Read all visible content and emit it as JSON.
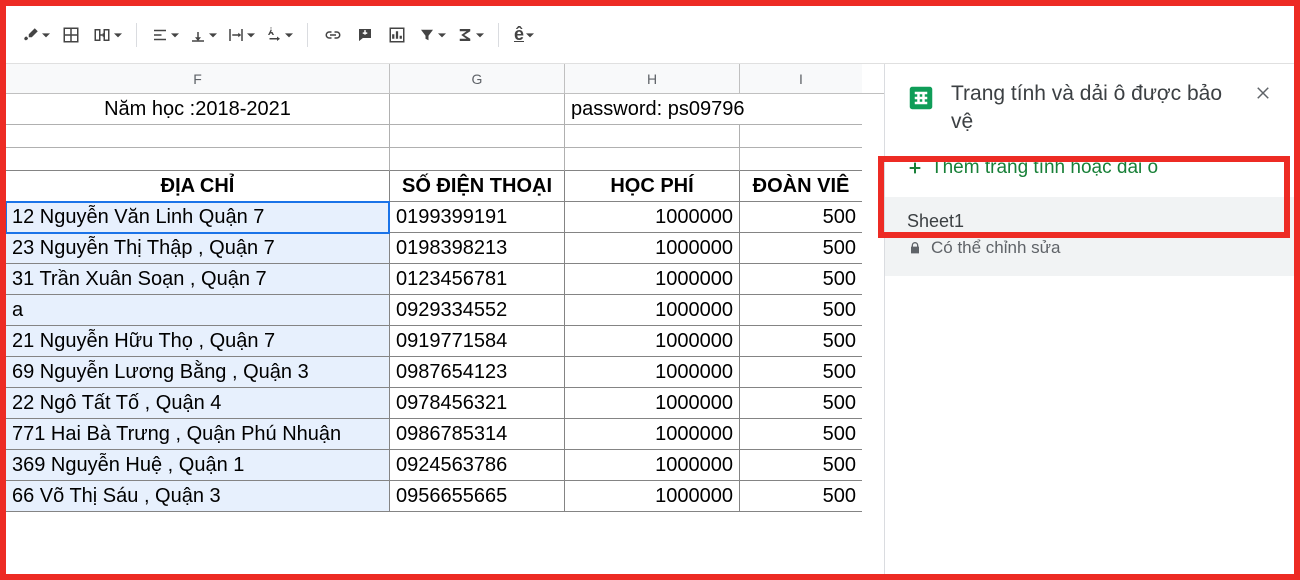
{
  "toolbar": {
    "icons": [
      "paint-icon",
      "borders-icon",
      "merge-icon",
      "halign-icon",
      "valign-icon",
      "wrap-icon",
      "rotate-icon",
      "link-icon",
      "insert-comment-icon",
      "chart-icon",
      "filter-icon",
      "functions-icon",
      "language-icon"
    ]
  },
  "columns": [
    "F",
    "G",
    "H",
    "I"
  ],
  "topmerge": {
    "left": "Năm học :2018-2021",
    "right": "password: ps09796"
  },
  "headers": {
    "F": "ĐỊA CHỈ",
    "G": "SỐ ĐIỆN THOẠI",
    "H": "HỌC PHÍ",
    "I": "ĐOÀN VIÊ"
  },
  "rows": [
    {
      "F": "12 Nguyễn Văn Linh Quận 7",
      "G": "0199399191",
      "H": "1000000",
      "I": "500"
    },
    {
      "F": "23 Nguyễn Thị Thập , Quận 7",
      "G": "0198398213",
      "H": "1000000",
      "I": "500"
    },
    {
      "F": "31 Trần Xuân Soạn , Quận 7",
      "G": "0123456781",
      "H": "1000000",
      "I": "500"
    },
    {
      "F": "a",
      "G": "0929334552",
      "H": "1000000",
      "I": "500"
    },
    {
      "F": "21 Nguyễn Hữu Thọ , Quận 7",
      "G": "0919771584",
      "H": "1000000",
      "I": "500"
    },
    {
      "F": "69 Nguyễn Lương Bằng , Quận 3",
      "G": "0987654123",
      "H": "1000000",
      "I": "500"
    },
    {
      "F": "22 Ngô Tất Tố , Quận 4",
      "G": "0978456321",
      "H": "1000000",
      "I": "500"
    },
    {
      "F": "771 Hai Bà Trưng , Quận Phú Nhuận",
      "G": "0986785314",
      "H": "1000000",
      "I": "500"
    },
    {
      "F": "369 Nguyễn Huệ , Quận 1",
      "G": "0924563786",
      "H": "1000000",
      "I": "500"
    },
    {
      "F": "66 Võ Thị Sáu , Quận 3",
      "G": "0956655665",
      "H": "1000000",
      "I": "500"
    }
  ],
  "panel": {
    "title": "Trang tính và dải ô được bảo vệ",
    "addLink": "Thêm trang tính hoặc dải ô",
    "rangeName": "Sheet1",
    "rangeSub": "Có thể chỉnh sửa"
  }
}
